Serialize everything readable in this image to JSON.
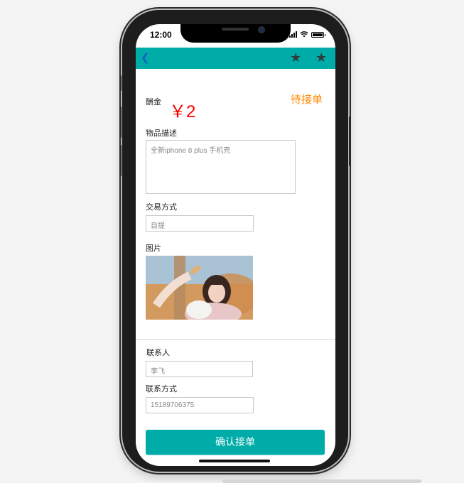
{
  "status_bar": {
    "time": "12:00"
  },
  "navbar": {
    "back_icon": "chevron-left-icon",
    "actions": [
      "star-icon",
      "star-icon"
    ]
  },
  "form": {
    "reward_label": "酬金",
    "reward_value": "￥2",
    "order_status": "待接单",
    "description_label": "物品描述",
    "description_value": "全新iphone 8 plus 手机壳",
    "trade_label": "交易方式",
    "trade_value": "自提",
    "image_label": "图片",
    "contact_label": "联系人",
    "contact_value": "李飞",
    "phone_label": "联系方式",
    "phone_value": "15189706375"
  },
  "actions": {
    "confirm_label": "确认接单"
  },
  "colors": {
    "primary": "#00aca8",
    "reward": "#ff0000",
    "status": "#ff8a00",
    "back": "#1565c0"
  }
}
